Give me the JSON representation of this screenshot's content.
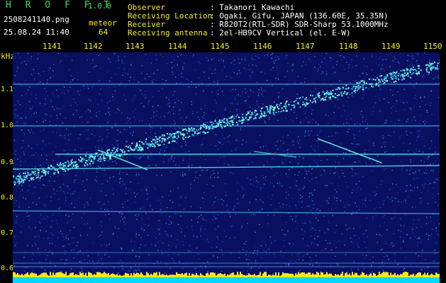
{
  "header": {
    "app_title": "H R O F F T",
    "app_version": "1.0.0",
    "file_name": "2508241140.png",
    "mode_label": "meteor",
    "timestamp": "25.08.24 11:40",
    "count": "64"
  },
  "info": [
    {
      "label": "Observer",
      "value": ": Takanori Kawachi"
    },
    {
      "label": "Receiving Location",
      "value": ": Ogaki, Gifu, JAPAN (136.60E, 35.35N)"
    },
    {
      "label": "Receiver",
      "value": ": R820T2(RTL-SDR) SDR-Sharp 53.1000MHz"
    },
    {
      "label": "Receiving antenna",
      "value": ": 2el-HB9CV Vertical (el. E-W)"
    }
  ],
  "x_axis": {
    "ticks": [
      "1141",
      "1142",
      "1143",
      "1144",
      "1145",
      "1146",
      "1147",
      "1148",
      "1149",
      "1150"
    ]
  },
  "y_axis": {
    "unit": "kHz",
    "ticks": [
      "1.1",
      "1.0",
      "0.9",
      "0.8",
      "0.7",
      "0.6"
    ]
  },
  "colors": {
    "background": "#0a1060",
    "label_yellow": "#f4f018",
    "label_green": "#36e05a",
    "signal": "#7fffe0",
    "baseline_bar": "#00e0ff"
  }
}
